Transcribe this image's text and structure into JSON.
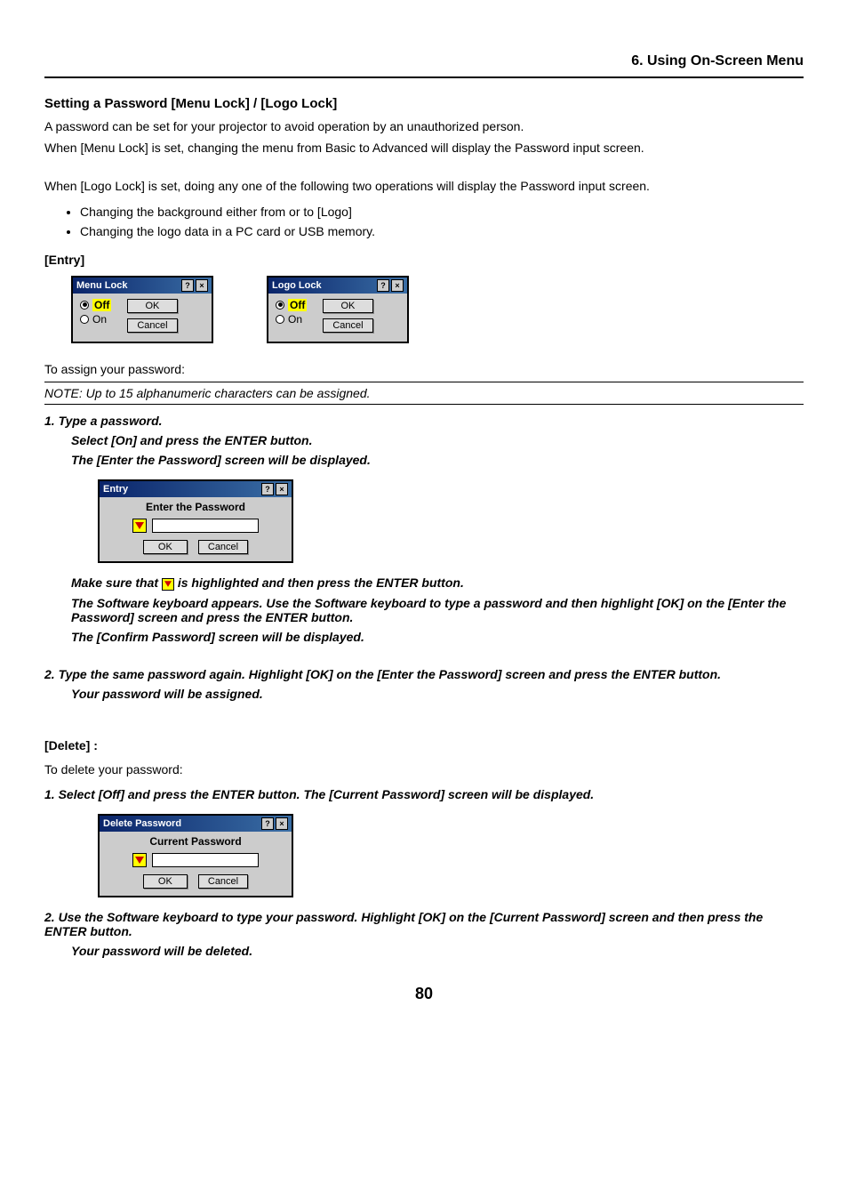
{
  "header": {
    "section": "6. Using On-Screen Menu"
  },
  "title": "Setting a Password [Menu Lock] / [Logo Lock]",
  "intro": {
    "p1": "A password can be set for your projector to avoid operation by an unauthorized person.",
    "p2": "When [Menu Lock] is set, changing the menu from Basic to Advanced will display the Password input screen.",
    "p3": "When [Logo Lock] is set, doing any one of the following two operations will display the Password input screen."
  },
  "bullets": [
    "Changing the background either from or to [Logo]",
    "Changing the logo data in a PC card or USB memory."
  ],
  "entry": {
    "heading": "[Entry]",
    "dialogs": {
      "menuLock": {
        "title": "Menu Lock",
        "off": "Off",
        "on": "On",
        "ok": "OK",
        "cancel": "Cancel"
      },
      "logoLock": {
        "title": "Logo Lock",
        "off": "Off",
        "on": "On",
        "ok": "OK",
        "cancel": "Cancel"
      }
    },
    "assign": "To assign your password:",
    "note": "NOTE: Up to 15 alphanumeric characters can be assigned.",
    "step1": {
      "num": "1.  Type a password.",
      "sub1": "Select [On] and press the ENTER button.",
      "sub2": "The [Enter the Password] screen will be displayed."
    },
    "entryDialog": {
      "title": "Entry",
      "label": "Enter the Password",
      "ok": "OK",
      "cancel": "Cancel"
    },
    "afterEntry": {
      "l1a": "Make sure that ",
      "l1b": " is highlighted and then press the ENTER button.",
      "l2": "The Software keyboard appears. Use the Software keyboard to type a password and then highlight [OK] on the [Enter the Password] screen and press the ENTER button.",
      "l3": "The [Confirm Password] screen will be displayed."
    },
    "step2": {
      "num": "2.  Type the same password again. Highlight [OK] on the [Enter the Password] screen and press the ENTER button.",
      "sub": "Your password will be assigned."
    }
  },
  "delete": {
    "heading": "[Delete] :",
    "intro": "To delete your password:",
    "step1": "1.  Select [Off] and press the ENTER button. The [Current Password] screen will be displayed.",
    "dialog": {
      "title": "Delete Password",
      "label": "Current Password",
      "ok": "OK",
      "cancel": "Cancel"
    },
    "step2": {
      "num": "2.  Use the Software keyboard to type your password. Highlight [OK] on the [Current Password] screen and then press the ENTER button.",
      "sub": "Your password will be deleted."
    }
  },
  "pageNumber": "80"
}
